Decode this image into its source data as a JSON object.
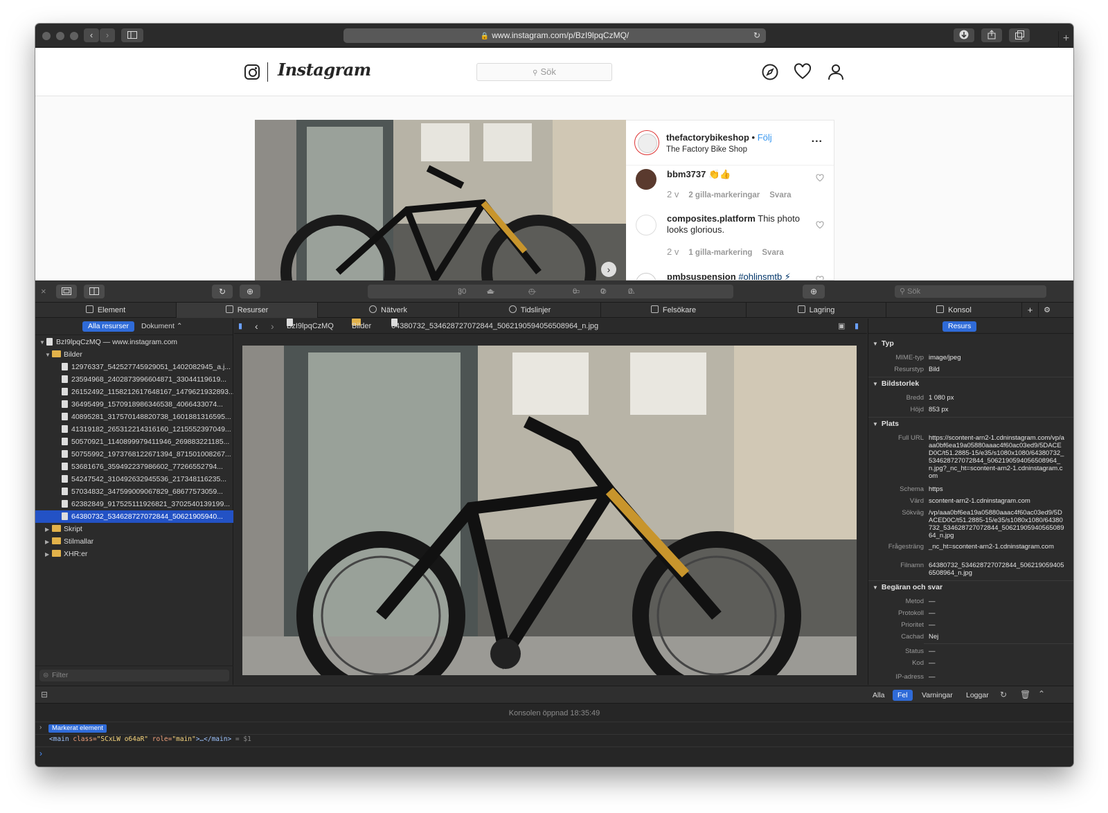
{
  "browser": {
    "url": "www.instagram.com/p/BzI9lpqCzMQ/"
  },
  "instagram": {
    "wordmark": "Instagram",
    "search_placeholder": "Sök",
    "post": {
      "username": "thefactorybikeshop",
      "separator": "•",
      "follow": "Följ",
      "subtitle": "The Factory Bike Shop",
      "more": "...",
      "comments": [
        {
          "user": "bbm3737",
          "text": "👏👍",
          "age": "2 v",
          "likes": "2 gilla-markeringar",
          "reply": "Svara"
        },
        {
          "user": "composites.platform",
          "text": "This photo looks glorious.",
          "age": "2 v",
          "likes": "1 gilla-markering",
          "reply": "Svara"
        },
        {
          "user": "pmbsuspension",
          "text": "#ohlinsmtb ⚡",
          "age": "",
          "likes": "",
          "reply": ""
        }
      ]
    }
  },
  "inspector": {
    "activity": {
      "resources": "30",
      "size": "—",
      "time": "—",
      "logs": "0",
      "errors": "0",
      "warnings": "0"
    },
    "search_placeholder": "Sök",
    "tabs": [
      "Element",
      "Resurser",
      "Nätverk",
      "Tidslinjer",
      "Felsökare",
      "Lagring",
      "Konsol"
    ],
    "filter": {
      "all": "Alla resurser",
      "doc": "Dokument ⌃"
    },
    "tree": {
      "root": "BzI9lpqCzMQ — www.instagram.com",
      "folder_images": "Bilder",
      "files": [
        "12976337_542527745929051_1402082945_a.j...",
        "23594968_2402873996604871_33044119619...",
        "26152492_1158212617648167_1479621932893...",
        "36495499_1570918986346538_4066433074...",
        "40895281_317570148820738_1601881316595...",
        "41319182_265312214316160_1215552397049...",
        "50570921_1140899979411946_269883221185...",
        "50755992_1973768122671394_871501008267...",
        "53681676_359492237986602_77266552794...",
        "54247542_310492632945536_217348116235...",
        "57034832_347599009067829_68677573059...",
        "62382849_917525111926821_3702540139199...",
        "64380732_534628727072844_50621905940..."
      ],
      "folders_after": [
        "Skript",
        "Stilmallar",
        "XHR:er"
      ],
      "filter_placeholder": "Filter"
    },
    "breadcrumb": {
      "page": "BzI9lpqCzMQ",
      "folder": "Bilder",
      "file": "64380732_534628727072844_5062190594056508964_n.jpg"
    },
    "details": {
      "tab": "Resurs",
      "typ_title": "Typ",
      "mime_k": "MIME-typ",
      "mime_v": "image/jpeg",
      "rtyp_k": "Resurstyp",
      "rtyp_v": "Bild",
      "size_title": "Bildstorlek",
      "width_k": "Bredd",
      "width_v": "1 080 px",
      "height_k": "Höjd",
      "height_v": "853 px",
      "place_title": "Plats",
      "url_k": "Full URL",
      "url_v": "https://scontent-arn2-1.cdninstagram.com/vp/aaa0bf6ea19a05880aaac4f60ac03ed9/5DACED0C/t51.2885-15/e35/s1080x1080/64380732_534628727072844_5062190594056508964_n.jpg?_nc_ht=scontent-arn2-1.cdninstagram.com",
      "scheme_k": "Schema",
      "scheme_v": "https",
      "host_k": "Värd",
      "host_v": "scontent-arn2-1.cdninstagram.com",
      "path_k": "Sökväg",
      "path_v": "/vp/aaa0bf6ea19a05880aaac4f60ac03ed9/5DACED0C/t51.2885-15/e35/s1080x1080/64380732_534628727072844_5062190594056508964_n.jpg",
      "query_k": "Frågesträng",
      "query_v": "_nc_ht=scontent-arn2-1.cdninstagram.com",
      "file_k": "Filnamn",
      "file_v": "64380732_534628727072844_5062190594056508964_n.jpg",
      "req_title": "Begäran och svar",
      "method_k": "Metod",
      "method_v": "—",
      "proto_k": "Protokoll",
      "proto_v": "—",
      "prio_k": "Prioritet",
      "prio_v": "—",
      "cached_k": "Cachad",
      "cached_v": "Nej",
      "status_k": "Status",
      "status_v": "—",
      "code_k": "Kod",
      "code_v": "—",
      "ip_k": "IP-adress",
      "ip_v": "—"
    },
    "console": {
      "filters": [
        "Alla",
        "Fel",
        "Varningar",
        "Loggar"
      ],
      "opened": "Konsolen öppnad 18:35:49",
      "badge": "Markerat element",
      "code_tag_open": "<main",
      "code_attr1": "class=",
      "code_val1": "\"SCxLW  o64aR\"",
      "code_attr2": "role=",
      "code_val2": "\"main\"",
      "code_tag_close": ">…</main>",
      "code_ref": "= $1"
    }
  }
}
